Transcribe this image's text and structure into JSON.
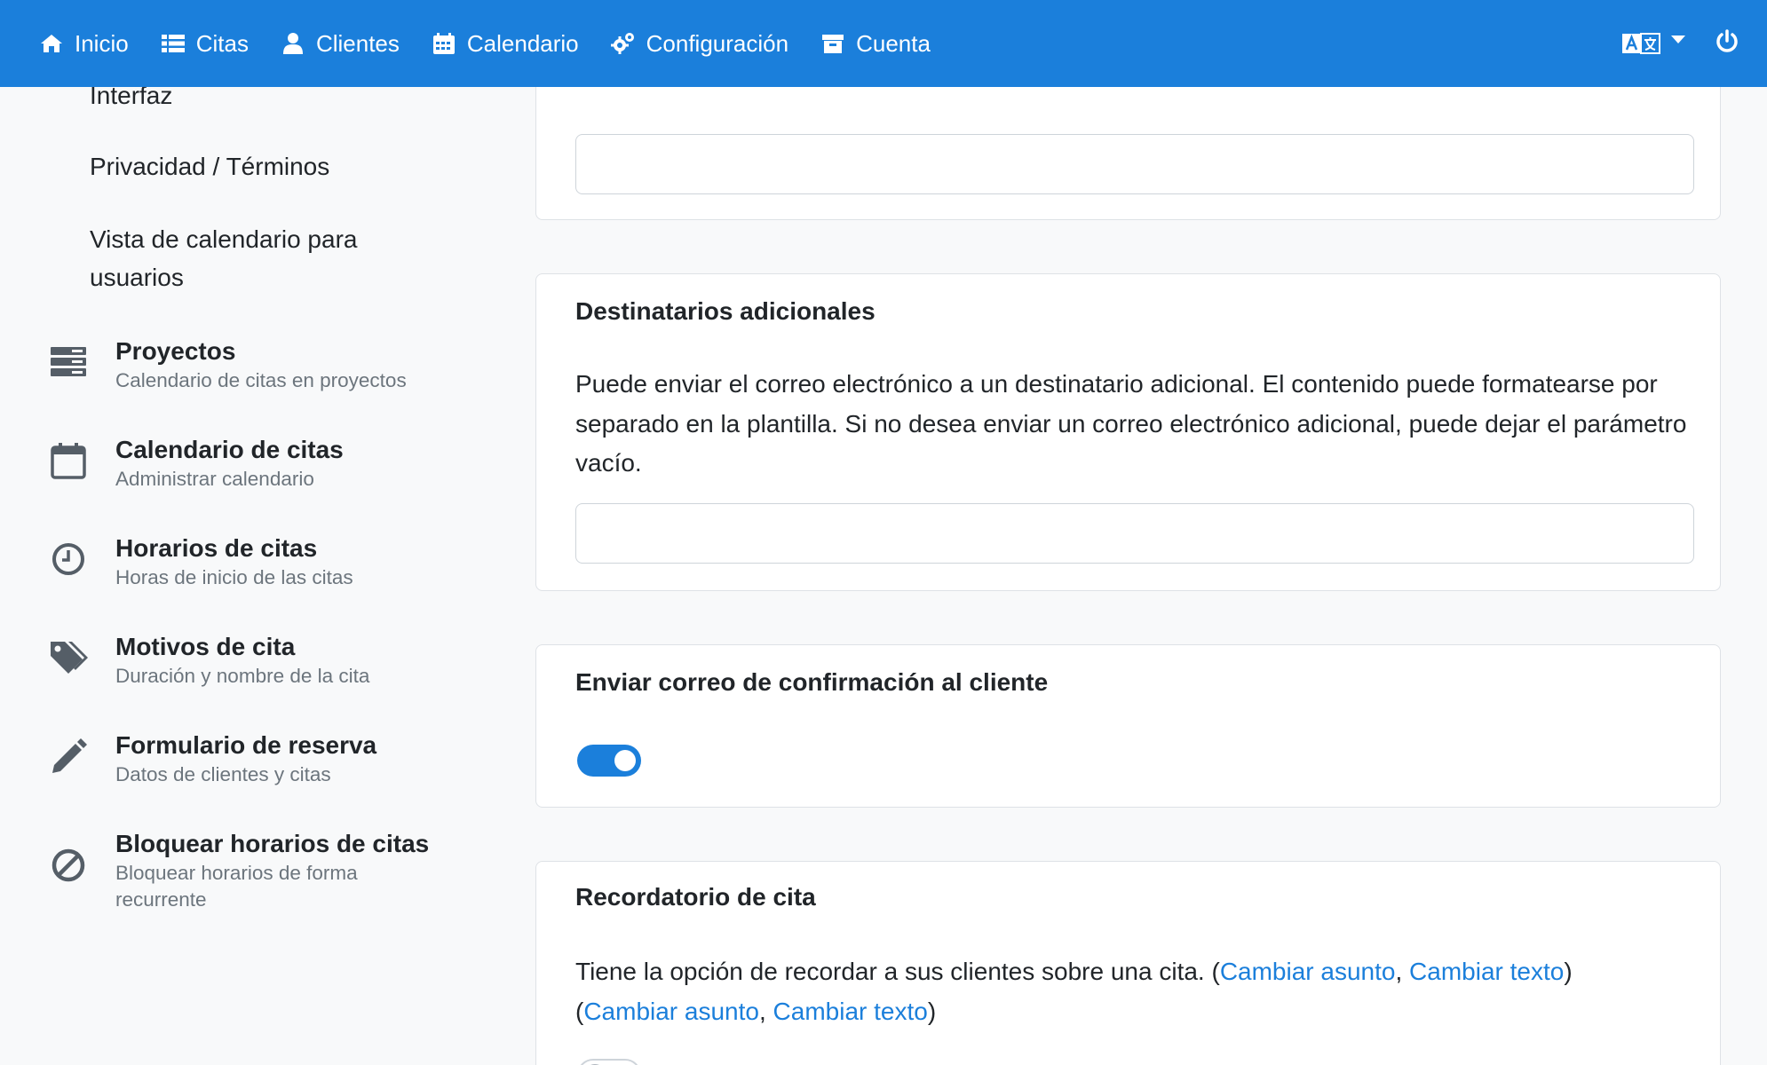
{
  "nav": {
    "items": [
      {
        "label": "Inicio",
        "icon": "home-icon"
      },
      {
        "label": "Citas",
        "icon": "list-icon"
      },
      {
        "label": "Clientes",
        "icon": "user-icon"
      },
      {
        "label": "Calendario",
        "icon": "calendar-icon"
      },
      {
        "label": "Configuración",
        "icon": "cogs-icon"
      },
      {
        "label": "Cuenta",
        "icon": "archive-icon"
      }
    ],
    "language_icon": "language-icon",
    "power_icon": "power-icon"
  },
  "sidebar": {
    "sub_items": [
      "Interfaz",
      "Privacidad / Términos",
      "Vista de calendario para usuarios"
    ],
    "items": [
      {
        "title": "Proyectos",
        "subtitle": "Calendario de citas en proyectos",
        "icon": "projects-icon"
      },
      {
        "title": "Calendario de citas",
        "subtitle": "Administrar calendario",
        "icon": "calendar-outline-icon"
      },
      {
        "title": "Horarios de citas",
        "subtitle": "Horas de inicio de las citas",
        "icon": "clock-icon"
      },
      {
        "title": "Motivos de cita",
        "subtitle": "Duración y nombre de la cita",
        "icon": "tags-icon"
      },
      {
        "title": "Formulario de reserva",
        "subtitle": "Datos de clientes y citas",
        "icon": "pencil-icon"
      },
      {
        "title": "Bloquear horarios de citas",
        "subtitle": "Bloquear horarios de forma recurrente",
        "icon": "ban-icon"
      }
    ]
  },
  "cards": {
    "top": {
      "input_value": ""
    },
    "recipients": {
      "title": "Destinatarios adicionales",
      "text": "Puede enviar el correo electrónico a un destinatario adicional. El contenido puede formatearse por separado en la plantilla. Si no desea enviar un correo electrónico adicional, puede dejar el parámetro vacío.",
      "input_value": ""
    },
    "confirmation": {
      "title": "Enviar correo de confirmación al cliente",
      "toggle_on": true
    },
    "reminder": {
      "title": "Recordatorio de cita",
      "text": "Tiene la opción de recordar a sus clientes sobre una cita.",
      "paren_open": "(",
      "paren_close": ")",
      "comma": ",",
      "link_subject": "Cambiar asunto",
      "link_text": "Cambiar texto",
      "toggle_on": false
    }
  }
}
